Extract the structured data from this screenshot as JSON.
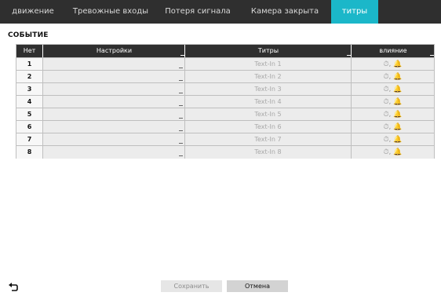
{
  "tabs": [
    {
      "label": "движение"
    },
    {
      "label": "Тревожные входы"
    },
    {
      "label": "Потеря сигнала"
    },
    {
      "label": "Камера закрыта"
    },
    {
      "label": "титры"
    }
  ],
  "section_title": "СОБЫТИЕ",
  "table": {
    "headers": [
      "Нет",
      "Настройки",
      "Титры",
      "влияние"
    ],
    "rows": [
      {
        "num": "1",
        "settings": "",
        "text": "Text-In 1",
        "actions": "⏱, 🔔"
      },
      {
        "num": "2",
        "settings": "",
        "text": "Text-In 2",
        "actions": "⏱, 🔔"
      },
      {
        "num": "3",
        "settings": "",
        "text": "Text-In 3",
        "actions": "⏱, 🔔"
      },
      {
        "num": "4",
        "settings": "",
        "text": "Text-In 4",
        "actions": "⏱, 🔔"
      },
      {
        "num": "5",
        "settings": "",
        "text": "Text-In 5",
        "actions": "⏱, 🔔"
      },
      {
        "num": "6",
        "settings": "",
        "text": "Text-In 6",
        "actions": "⏱, 🔔"
      },
      {
        "num": "7",
        "settings": "",
        "text": "Text-In 7",
        "actions": "⏱, 🔔"
      },
      {
        "num": "8",
        "settings": "",
        "text": "Text-In 8",
        "actions": "⏱, 🔔"
      }
    ]
  },
  "buttons": {
    "save": "Сохранить",
    "cancel": "Отмена"
  },
  "icons": {
    "back": "back-arrow-icon"
  },
  "colors": {
    "active_tab": "#1bb7c9",
    "header_bg": "#2f2f2f"
  }
}
